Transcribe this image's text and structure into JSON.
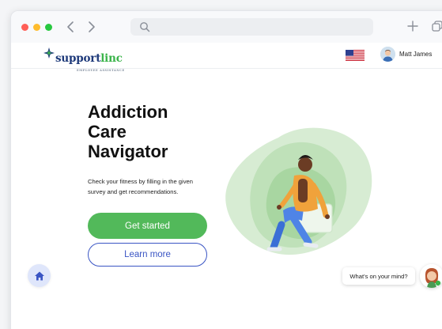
{
  "browser": {
    "address_value": "",
    "icons": [
      "close-dot",
      "minimize-dot",
      "maximize-dot",
      "back-arrow-icon",
      "forward-arrow-icon",
      "search-icon",
      "plus-icon",
      "tabs-icon"
    ]
  },
  "header": {
    "logo": {
      "primary": "support",
      "accent": "linc",
      "tagline": "EMPLOYEE ASSISTANCE"
    },
    "user_name": "Matt James",
    "flag_icon": "us-flag-icon"
  },
  "hero": {
    "title_lines": [
      "Addiction",
      "Care",
      "Navigator"
    ],
    "description": "Check your fitness by filling in the given survey and get recommendations.",
    "primary_button": "Get started",
    "secondary_button": "Learn more"
  },
  "chat": {
    "prompt": "What's on your mind?"
  },
  "colors": {
    "brand_navy": "#1e3a7a",
    "brand_green": "#3bb44a",
    "primary_button": "#52b95a",
    "secondary_button_border": "#3a55c4",
    "home_fab_bg": "#dfe6fb"
  }
}
